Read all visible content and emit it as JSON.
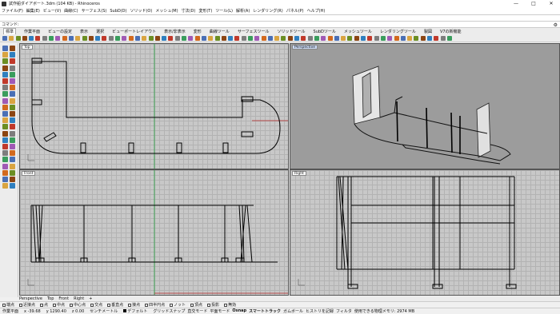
{
  "window": {
    "title": "試作船ダイアボート.3dm (104 KB) - Rhinoceros",
    "minimize": "—",
    "maximize": "□",
    "close": "✕"
  },
  "menu": [
    "ファイル(F)",
    "編集(E)",
    "ビュー(V)",
    "曲線(C)",
    "サーフェス(S)",
    "SubD(D)",
    "ソリッド(O)",
    "メッシュ(M)",
    "寸法(D)",
    "変形(T)",
    "ツール(L)",
    "解析(A)",
    "レンダリング(R)",
    "パネル(P)",
    "ヘルプ(H)"
  ],
  "command": {
    "label": "コマンド:",
    "value": ""
  },
  "tabs": [
    "標準",
    "作業平面",
    "ビューの設定",
    "表示",
    "選択",
    "ビューポートレイアウト",
    "表示/非表示",
    "変形",
    "曲線ツール",
    "サーフェスツール",
    "ソリッドツール",
    "SubDツール",
    "メッシュツール",
    "レンダリングツール",
    "製図",
    "V7の新機能"
  ],
  "active_tab": 0,
  "viewports": {
    "top": "Top",
    "perspective": "Perspective",
    "front": "Front",
    "right": "Right"
  },
  "bottom_tabs": [
    "Perspective",
    "Top",
    "Front",
    "Right",
    "+"
  ],
  "osnaps": [
    "端点",
    "近接点",
    "点",
    "中点",
    "中心点",
    "交点",
    "垂直点",
    "接点",
    "四半円点",
    "ノット",
    "頂点",
    "投影",
    "無効"
  ],
  "status": {
    "plane": "作業平面",
    "x": "x -39.68",
    "y": "y 1290.40",
    "z": "z 0.00",
    "units": "センチメートル",
    "layer": "デフォルト",
    "panes": [
      "グリッドスナップ",
      "直交モード",
      "平面モード",
      "Osnap",
      "スマートトラック",
      "ガムボール",
      "ヒストリを記録",
      "フィルタ",
      "使用できる物理メモリ: 2974 MB"
    ]
  },
  "colors": {
    "accent": "#c9d8f2",
    "axis_x": "#b22222",
    "axis_y": "#1f9e3a"
  }
}
